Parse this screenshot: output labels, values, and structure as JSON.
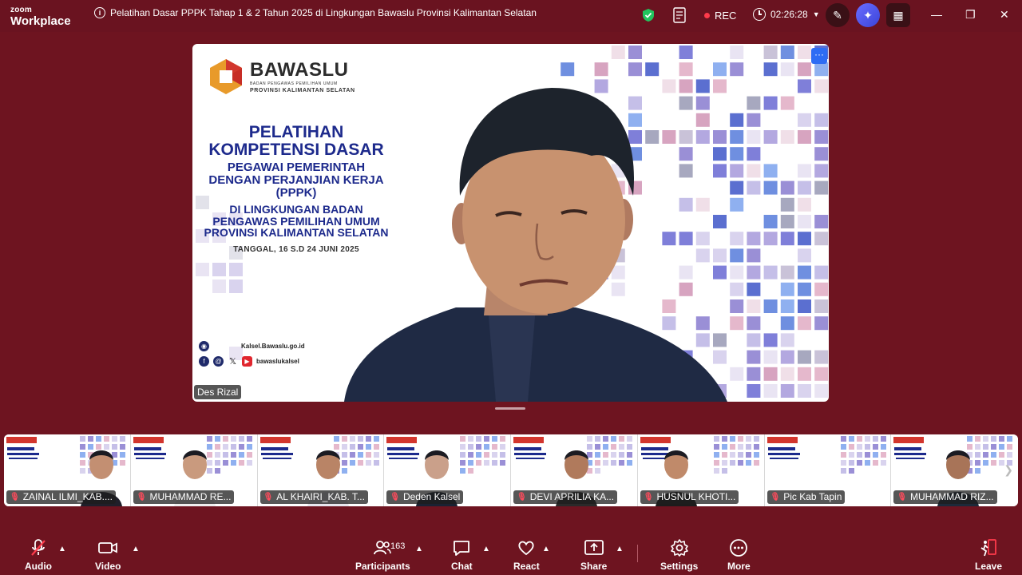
{
  "app": {
    "brand_line1": "zoom",
    "brand_line2": "Workplace"
  },
  "meeting": {
    "title": "Pelatihan Dasar PPPK Tahap 1 & 2 Tahun 2025 di Lingkungan Bawaslu Provinsi Kalimantan Selatan",
    "recording_label": "REC",
    "elapsed": "02:26:28"
  },
  "colors": {
    "background": "#6e1420",
    "accent": "#2e6cf4",
    "rec": "#ff3b4b",
    "slide_text": "#1d2a8c"
  },
  "main": {
    "speaker_name": "Des Rizal",
    "more_label": "···",
    "slide": {
      "logo_name": "BAWASLU",
      "logo_sub1": "BADAN PENGAWAS PEMILIHAN UMUM",
      "logo_sub2": "PROVINSI KALIMANTAN SELATAN",
      "title_l1": "PELATIHAN",
      "title_l2": "KOMPETENSI DASAR",
      "sub_l1": "PEGAWAI PEMERINTAH",
      "sub_l2": "DENGAN PERJANJIAN KERJA",
      "sub_l3": "(PPPK)",
      "loc_l1": "DI LINGKUNGAN BADAN",
      "loc_l2": "PENGAWAS PEMILIHAN UMUM",
      "loc_l3": "PROVINSI KALIMANTAN SELATAN",
      "date": "TANGGAL, 16 S.D 24 JUNI 2025",
      "website": "Kalsel.Bawaslu.go.id",
      "handle": "bawaslukalsel"
    }
  },
  "gallery": {
    "tiles": [
      {
        "name": "ZAINAL ILMI_KAB...."
      },
      {
        "name": "MUHAMMAD RE..."
      },
      {
        "name": "AL KHAIRI_KAB. T..."
      },
      {
        "name": "Deden Kalsel"
      },
      {
        "name": "DEVI APRILIA KA..."
      },
      {
        "name": "HUSNUL KHOTI..."
      },
      {
        "name": "Pic Kab Tapin"
      },
      {
        "name": "MUHAMMAD RIZ..."
      }
    ]
  },
  "toolbar": {
    "audio": "Audio",
    "video": "Video",
    "participants": "Participants",
    "participants_count": "163",
    "chat": "Chat",
    "react": "React",
    "share": "Share",
    "settings": "Settings",
    "more": "More",
    "leave": "Leave"
  }
}
